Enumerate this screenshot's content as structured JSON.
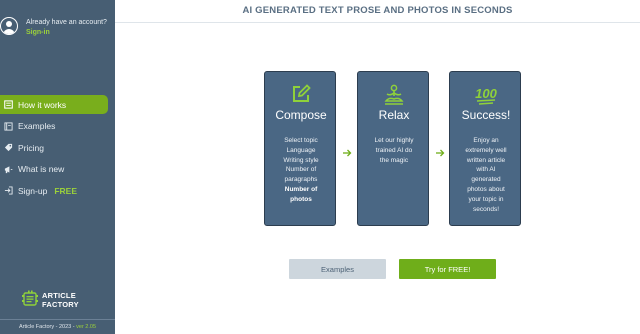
{
  "account": {
    "prompt": "Already have an account?",
    "signin_label": "Sign-in"
  },
  "sidebar": {
    "items": [
      {
        "label": "How it works",
        "icon": "how-it-works-icon",
        "active": true
      },
      {
        "label": "Examples",
        "icon": "book-icon",
        "active": false
      },
      {
        "label": "Pricing",
        "icon": "price-tag-icon",
        "active": false
      },
      {
        "label": "What is new",
        "icon": "megaphone-icon",
        "active": false
      },
      {
        "label": "Sign-up",
        "icon": "sign-in-icon",
        "active": false,
        "badge": "FREE"
      }
    ],
    "logo_line1": "ARTICLE",
    "logo_line2": "FACTORY",
    "footer_text": "Article Factory - 2023 - ",
    "footer_version": "ver 2.05"
  },
  "header": {
    "title": "AI GENERATED TEXT PROSE AND PHOTOS IN SECONDS"
  },
  "cards": [
    {
      "title": "Compose",
      "icon": "pencil-square-icon",
      "lines": [
        "Select topic",
        "Language",
        "Writing style",
        "Number of",
        "paragraphs"
      ],
      "bold_lines": [
        "Number of",
        "photos"
      ]
    },
    {
      "title": "Relax",
      "icon": "meditation-icon",
      "lines": [
        "Let our highly",
        "trained AI do",
        "the magic"
      ]
    },
    {
      "title": "Success!",
      "icon": "hundred-icon",
      "icon_text": "100",
      "lines": [
        "Enjoy an",
        "extremely well",
        "written article",
        "with AI",
        "generated",
        "photos about",
        "your topic in",
        "seconds!"
      ]
    }
  ],
  "buttons": {
    "examples_label": "Examples",
    "try_label": "Try for FREE!"
  },
  "colors": {
    "sidebar_bg": "#475e73",
    "accent_green": "#79ae1c",
    "card_bg": "#4a6784",
    "icon_green": "#8fd13a"
  }
}
